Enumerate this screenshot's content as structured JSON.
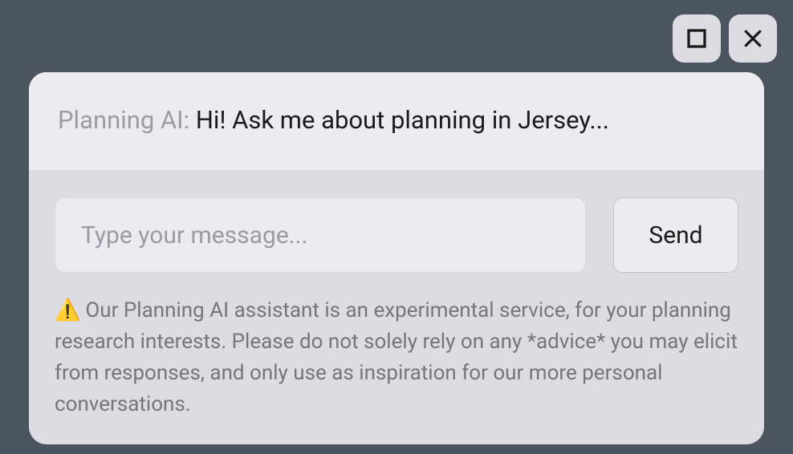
{
  "window": {
    "maximize_name": "maximize-icon",
    "close_name": "close-icon"
  },
  "header": {
    "label": "Planning AI: ",
    "greeting": "Hi! Ask me about planning in Jersey..."
  },
  "input": {
    "placeholder": "Type your message...",
    "send_label": "Send"
  },
  "disclaimer": {
    "icon": "⚠️",
    "text": "Our Planning AI assistant is an experimental service, for your planning research interests. Please do not solely rely on any *advice* you may elicit from responses, and only use as inspiration for our more personal conversations."
  }
}
